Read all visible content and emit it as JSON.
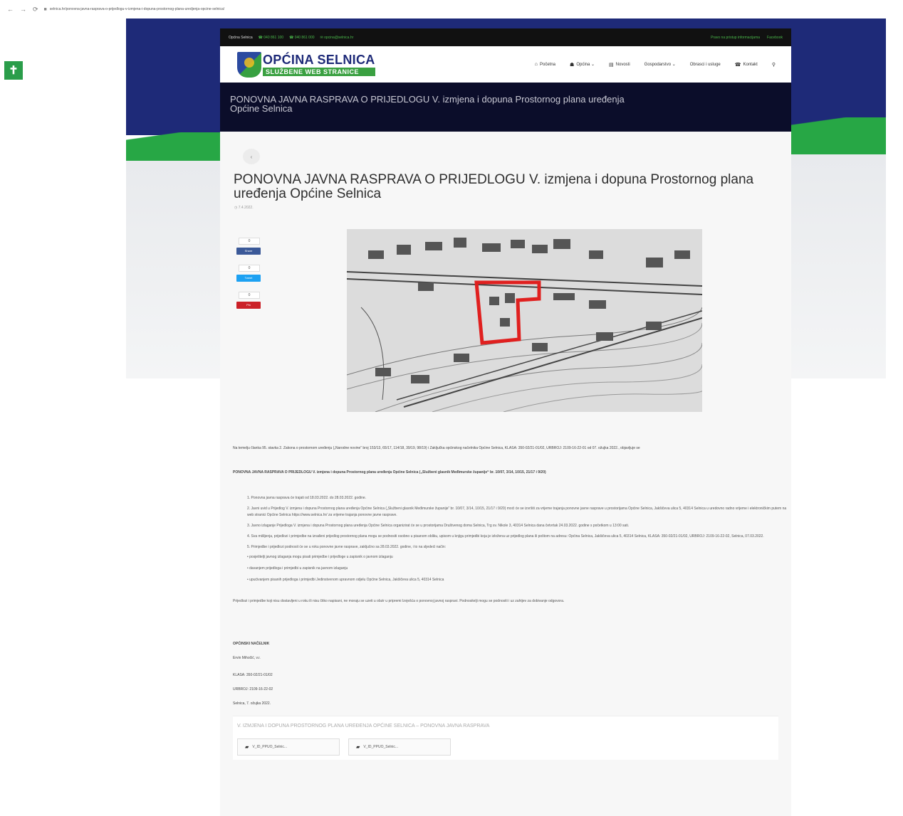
{
  "browser": {
    "nav_icons": [
      "←",
      "→",
      "⟳"
    ],
    "url": "selnica.hr/ponovna-javna-rasprava-o-prijedlogu-v-izmjena-i-dopuna-prostornog-plana-uredjenja-opcine-selnica/"
  },
  "topbar": {
    "name": "Općina Selnica",
    "phone1": "☎ 040 861 100",
    "phone2": "☎ 040 861 000",
    "email": "✉ opcina@selnica.hr",
    "right1": "Pravo na pristup informacijama",
    "right2": "Facebook"
  },
  "logo": {
    "title": "OPĆINA SELNICA",
    "subtitle": "SLUŽBENE WEB STRANICE"
  },
  "nav": [
    {
      "icon": "⌂",
      "label": "Početna"
    },
    {
      "icon": "☗",
      "label": "Općina ⌄"
    },
    {
      "icon": "▤",
      "label": "Novosti"
    },
    {
      "icon": "",
      "label": "Gospodarstvo ⌄"
    },
    {
      "icon": "",
      "label": "Obrasci i usluge"
    },
    {
      "icon": "☎",
      "label": "Kontakt"
    },
    {
      "icon": "⚲",
      "label": ""
    }
  ],
  "title_band": "PONOVNA JAVNA RASPRAVA O PRIJEDLOGU  V. izmjena i dopuna Prostornog plana uređenja Općine Selnica",
  "article": {
    "title": "PONOVNA JAVNA RASPRAVA O PRIJEDLOGU  V. izmjena i dopuna Prostornog plana uređenja Općine Selnica",
    "date": "◷ 7.4.2022."
  },
  "share": {
    "fb_count": "0",
    "fb_label": "Share",
    "tw_count": "0",
    "tw_label": "Tweet",
    "pin_count": "0",
    "pin_label": "Pin"
  },
  "body": {
    "p1": "Na temelju članka 95. stavka 2. Zakona o prostornom uređenju („Narodne novine“ broj 153/13, 65/17, 114/18, 39/19, 98/19) i Zaključka općinskog načelnika Općine Selnica, KLASA: 350-02/21-01/02, URBROJ: 2109-16-22-01 od 07. ožujka 2022., objavljuje se",
    "p2": "PONOVNA JAVNA RASPRAVA O PRIJEDLOGU  V. izmjena i dopuna Prostornog plana uređenja Općine Selnica („Službeni glasnik Međimurske županije“ br. 10/07, 3/14, 10/15, 21/17 i 9/20)",
    "steps": [
      "1. Ponovna javna rasprava će trajati od 18.03.2022. do 28.03.2022. godine.",
      "2. Javni uvid u Prijedlog V. izmjena i dopuna Prostornog plana uređenja Općine Selnica („Službeni glasnik Međimurske županije“ br. 10/07, 3/14, 10/15, 21/17 i 9/20) moći će se izvršiti za vrijeme trajanja ponovne javne rasprave u prostorijama Općine Selnica, Jakšičeva ulica 5, 40314 Selnica u uredovno radno vrijeme i elektroničkim putem na web stranici Općine Selnica https://www.selnica.hr/ za vrijeme trajanja ponovne javne rasprave.",
      "3. Javno izlaganje Prijedloga V. izmjena i dopuna Prostornog plana uređenja Općine Selnica organizirat će se u prostorijama Društvenog doma Selnica, Trg sv. Nikole 3, 40314 Selnica dana četvrtak 24.03.2022. godine s početkom u 13:00 sati.",
      "4. Sva mišljenja, prijedlozi i primjedbe na izrađeni prijedlog prostornog plana mogu se podnositi osobno u pisanom obliku, upisom u knjigu primjedbi koja je izložena uz prijedlog plana ili poštom na adresu: Općina Selnica, Jakšičeva ulica 5, 40314 Selnica, KLASA: 350-02/21-01/02, URBROJ: 2109-16-22-02, Selnica, 07.03.2022.",
      "5. Primjedbe i prijedlozi podnosit će se u roku ponovne javne rasprave, zaključno sa 28.03.2022. godine, i to na sljedeći način:"
    ],
    "bullets": [
      "•  posjetitelji javnog izlaganja mogu pisati primjedbe i prijedloge u zapisnik o javnom izlaganju",
      "•  davanjem prijedloga i primjedbi u zapisnik na javnom izlaganju",
      "•  upućivanjem pisanih prijedloga i primjedbi Jedinstvenom upravnom odjelu Općine Selnica, Jakšičeva ulica 5, 40314 Selnica"
    ],
    "p3": "Prijedlozi i primjedbe koji nisu dostavljeni u roku ili nisu čitko napisani, ne moraju se uzeti u obzir u pripremi Izvješća o ponovnoj javnoj raspravi. Podnositelji mogu se podnositi i uz zahtjev za dobivanje odgovora."
  },
  "signature": {
    "role": "OPĆINSKI NAČELNIK",
    "name": "Ervin Mihočić, v.r.",
    "klasa": "KLASA: 350-02/21-01/02",
    "urbroj": "URBROJ: 2109-16-22-02",
    "place_date": "Selnica, 7. ožujka 2022."
  },
  "downloads": {
    "title": "V. IZMJENA I DOPUNA PROSTORNOG PLANA UREĐENJA OPĆINE SELNICA – PONOVNA JAVNA RASPRAVA",
    "files": [
      "V_ID_PPUO_Selnic...",
      "V_ID_PPUO_Selnic..."
    ]
  },
  "colors": {
    "navy": "#1e2a78",
    "green": "#27a745",
    "dark_band": "#0b0d2a",
    "highlight_red": "#e0201f"
  }
}
